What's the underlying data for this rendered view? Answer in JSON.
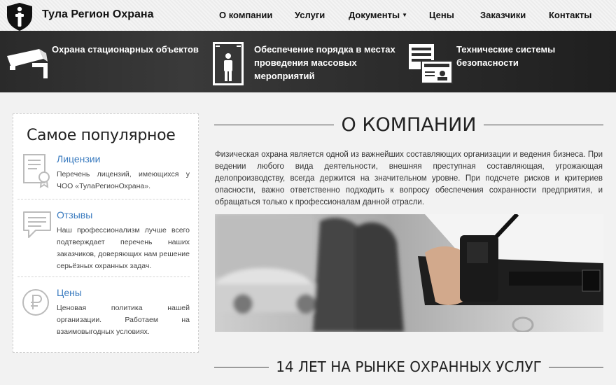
{
  "brand": {
    "name": "Тула Регион Охрана"
  },
  "nav": [
    {
      "label": "О компании"
    },
    {
      "label": "Услуги"
    },
    {
      "label": "Документы",
      "has_dropdown": true
    },
    {
      "label": "Цены"
    },
    {
      "label": "Заказчики"
    },
    {
      "label": "Контакты"
    }
  ],
  "services": [
    {
      "title": "Охрана стационарных объектов",
      "icon": "security-camera-icon"
    },
    {
      "title_lines": [
        "Обеспечение порядка в местах",
        "проведения массовых",
        "мероприятий"
      ],
      "icon": "metal-detector-gate-icon"
    },
    {
      "title_lines": [
        "Технические системы",
        "безопасности"
      ],
      "icon": "id-card-system-icon"
    }
  ],
  "sidebar": {
    "title": "Самое популярное",
    "items": [
      {
        "title": "Лицензии",
        "text": "Перечень лицензий, имеющихся у ЧОО «ТулаРегионОхрана».",
        "icon": "certificate-icon"
      },
      {
        "title": "Отзывы",
        "text": "Наш профессионализм лучше всего подтверждает перечень наших заказчиков, доверяющих нам решение серьёзных охранных задач.",
        "icon": "speech-bubble-icon"
      },
      {
        "title": "Цены",
        "text": "Ценовая политика нашей организации. Работаем на взаимовыгодных условиях.",
        "icon": "ruble-icon"
      }
    ]
  },
  "main": {
    "about_heading": "О КОМПАНИИ",
    "about_text": "Физическая охрана является одной из важнейших составляющих организации и ведения бизнеса. При ведении любого вида деятельности, внешняя преступная составляющая, угрожающая делопроизводству, всегда держится на значительном уровне. При подсчете рисков и критериев опасности, важно ответственно подходить к вопросу обеспечения сохранности предприятия, и обращаться только к профессионалам данной отрасли.",
    "years_heading": "14 ЛЕТ НА РЫНКЕ ОХРАННЫХ УСЛУГ"
  }
}
